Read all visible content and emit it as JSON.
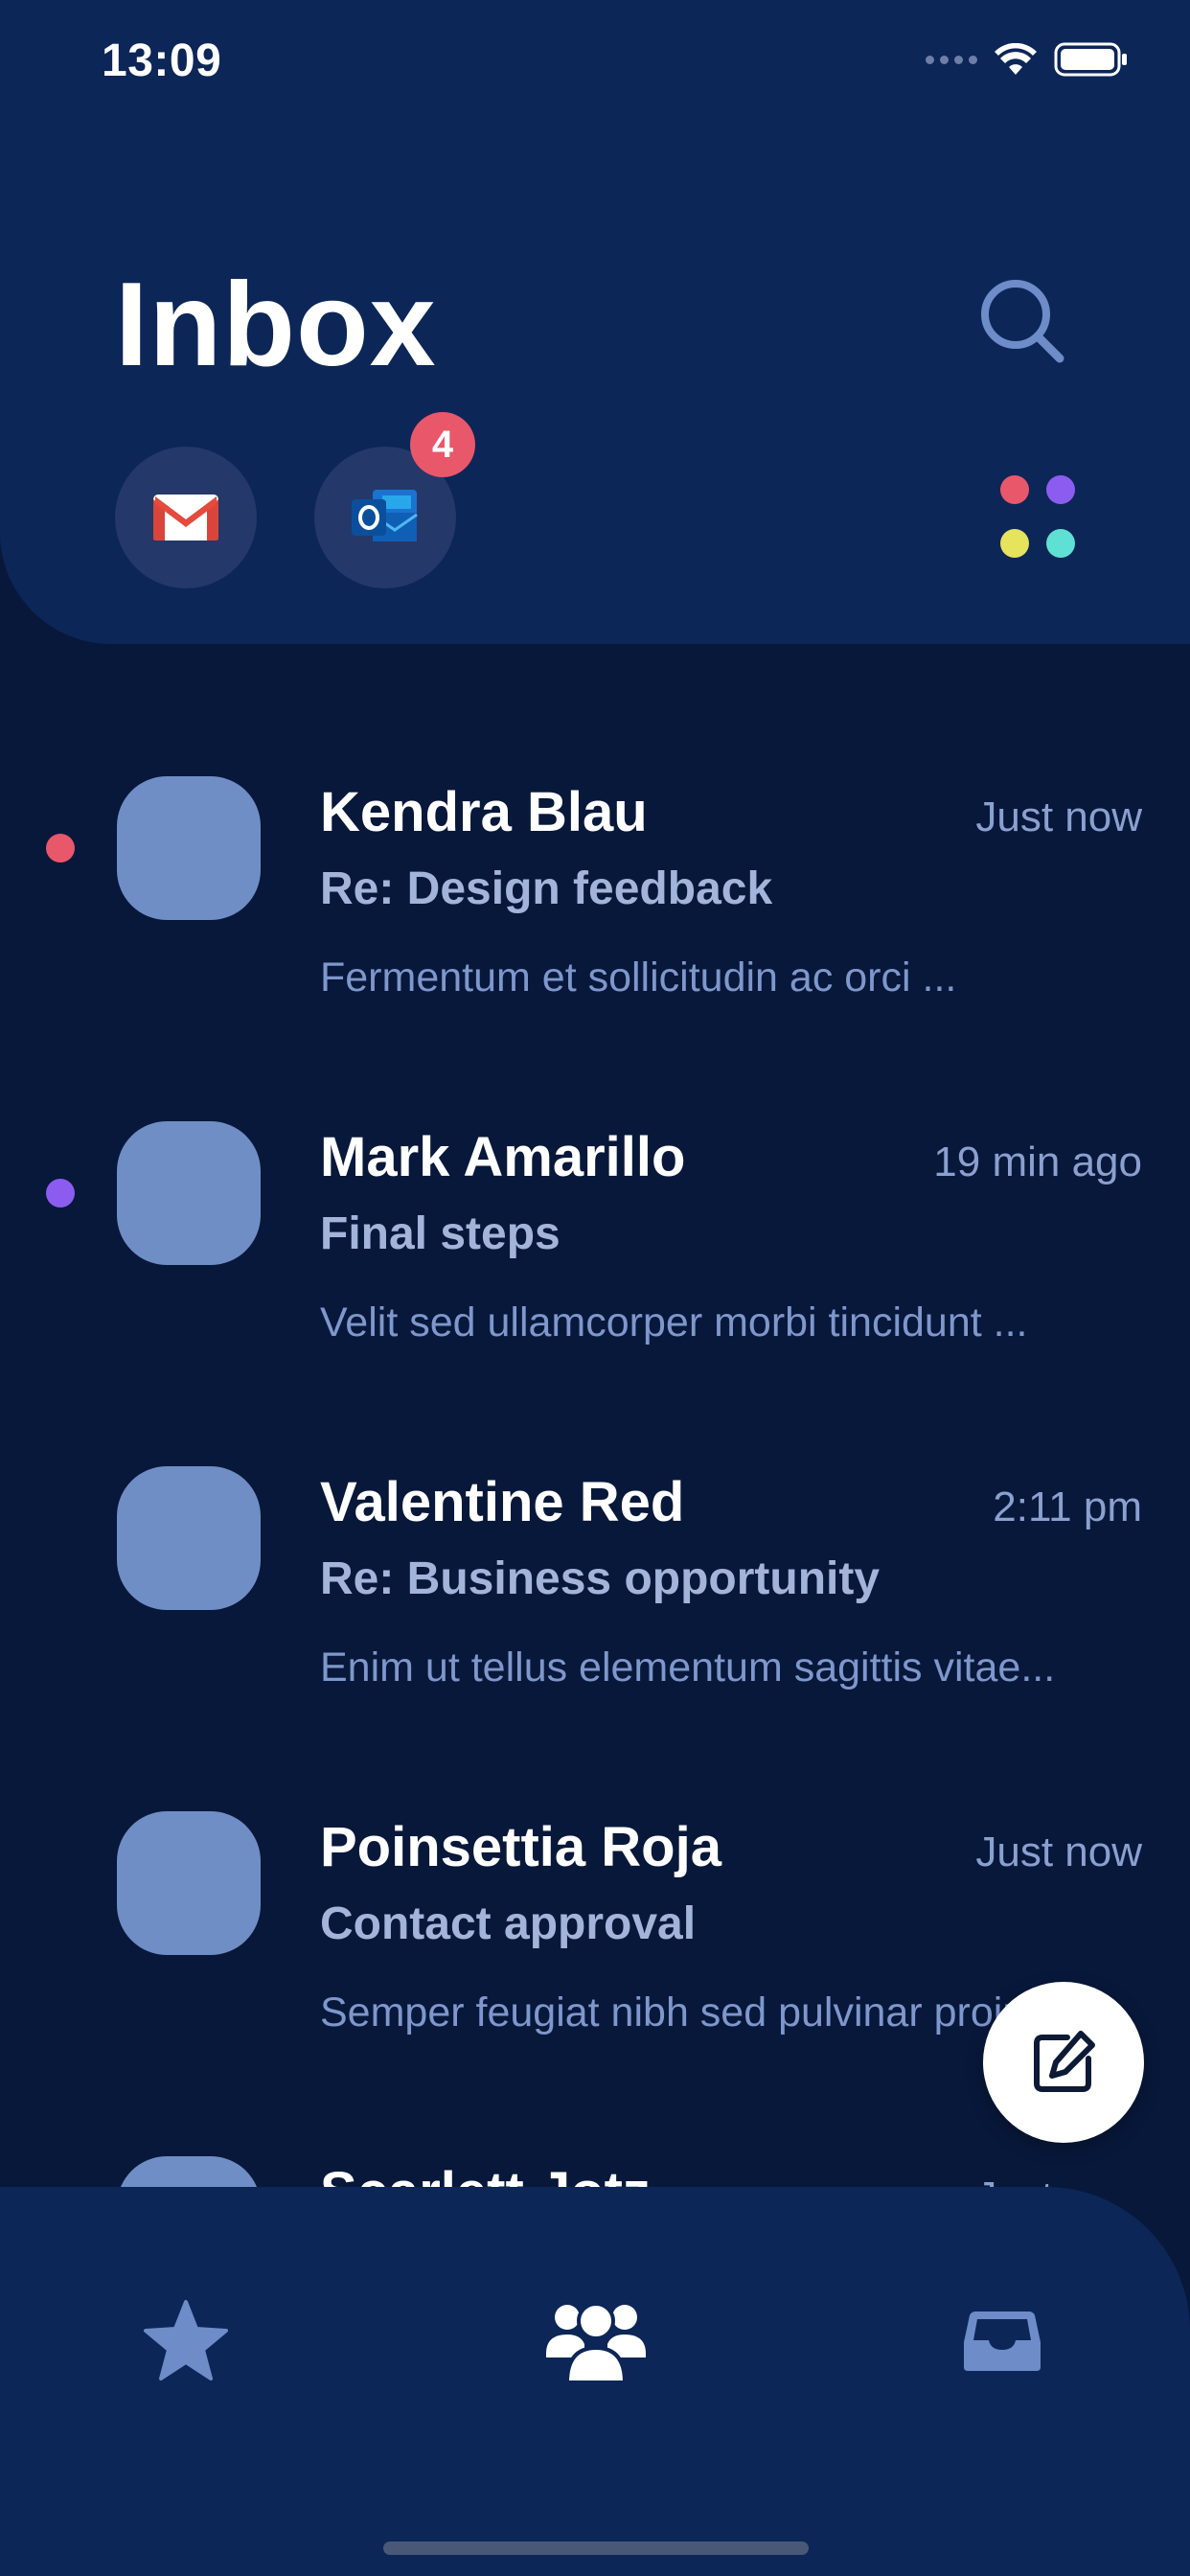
{
  "status_bar": {
    "time": "13:09"
  },
  "header": {
    "title": "Inbox",
    "search_icon": "search-icon",
    "accounts": [
      {
        "name": "Gmail",
        "icon": "gmail-icon"
      },
      {
        "name": "Outlook",
        "icon": "outlook-icon",
        "badge": "4"
      }
    ],
    "labels_icon": "label-dots-icon",
    "label_colors": [
      "#e9576b",
      "#8c5cf0",
      "#e6e35c",
      "#5fe0d5"
    ]
  },
  "emails": [
    {
      "sender": "Kendra Blau",
      "time": "Just now",
      "subject": "Re: Design feedback",
      "snippet": "Fermentum et sollicitudin ac orci ...",
      "unread_color": "#e9576b"
    },
    {
      "sender": "Mark Amarillo",
      "time": "19 min ago",
      "subject": "Final steps",
      "snippet": "Velit sed ullamcorper morbi tincidunt ...",
      "unread_color": "#8c5cf0"
    },
    {
      "sender": "Valentine Red",
      "time": "2:11 pm",
      "subject": "Re: Business opportunity",
      "snippet": "Enim ut tellus elementum sagittis vitae...",
      "unread_color": ""
    },
    {
      "sender": "Poinsettia Roja",
      "time": "Just now",
      "subject": "Contact approval",
      "snippet": "Semper feugiat nibh sed pulvinar proin...",
      "unread_color": ""
    },
    {
      "sender": "Scarlett Jotz",
      "time": "Just now",
      "subject": "",
      "snippet": "",
      "unread_color": ""
    }
  ],
  "compose": {
    "icon": "compose-icon"
  },
  "bottom_nav": {
    "items": [
      {
        "icon": "star-icon",
        "active": false
      },
      {
        "icon": "people-icon",
        "active": true
      },
      {
        "icon": "inbox-tray-icon",
        "active": false
      }
    ]
  },
  "colors": {
    "background": "#08183a",
    "header": "#0c2657",
    "avatar": "#6f8ec5",
    "badge": "#e9576b",
    "muted_text": "#8aa0cf"
  }
}
